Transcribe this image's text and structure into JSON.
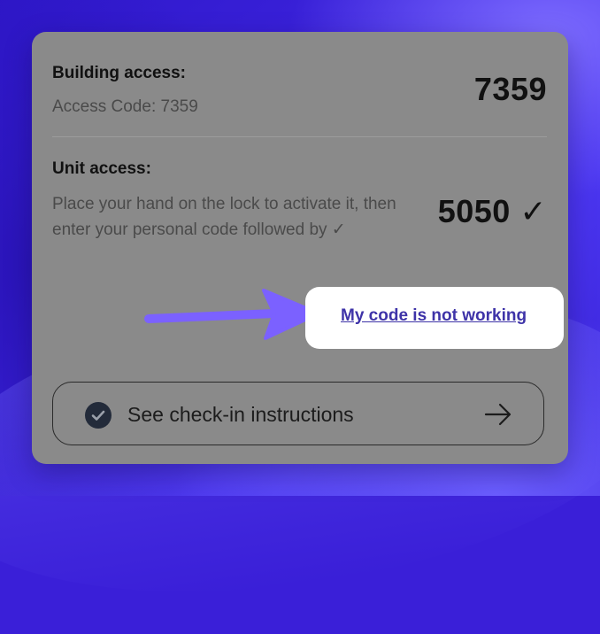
{
  "building": {
    "label": "Building access:",
    "subtext": "Access Code: 7359",
    "code": "7359"
  },
  "unit": {
    "label": "Unit access:",
    "description": "Place your hand on the lock to activate it, then enter your personal code followed by ✓",
    "code": "5050 ✓"
  },
  "help": {
    "link_label": "My code is not working"
  },
  "checkin": {
    "label": "See check-in instructions"
  },
  "colors": {
    "background": "#3a1fd8",
    "card": "#8a8a8a",
    "arrow": "#7b61ff",
    "link": "#3e33a8"
  },
  "icons": {
    "check": "check-circle-icon",
    "arrow": "arrow-right-icon",
    "pointer": "pointer-arrow-icon"
  }
}
